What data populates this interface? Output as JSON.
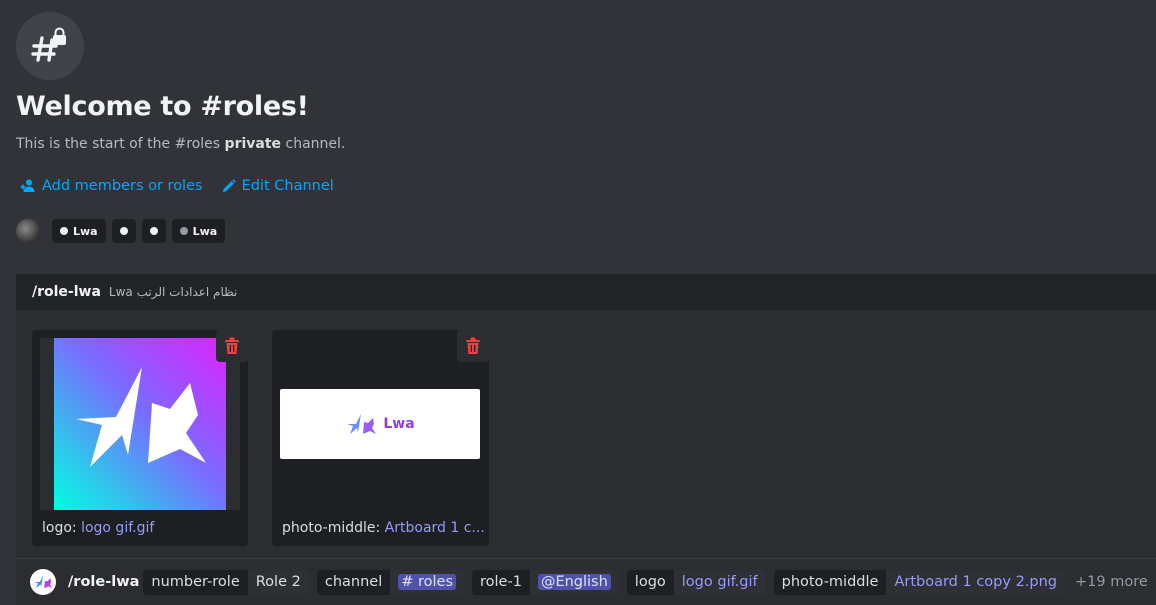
{
  "header": {
    "title": "Welcome to #roles!",
    "subtitle_pre": "This is the start of the #roles ",
    "subtitle_bold": "private",
    "subtitle_post": " channel."
  },
  "actions": {
    "add_members": "Add members or roles",
    "edit_channel": "Edit Channel"
  },
  "members": {
    "pills": [
      {
        "label": "Lwa"
      },
      {
        "label": ""
      },
      {
        "label": ""
      },
      {
        "label": "Lwa"
      }
    ]
  },
  "embed": {
    "command": "/role-lwa",
    "description": "Lwa نظام اعدادات الرتب",
    "cards": [
      {
        "label": "logo:",
        "file": "logo gif.gif"
      },
      {
        "label": "photo-middle:",
        "file": "Artboard 1 c..."
      }
    ],
    "image_brand": "Lwa"
  },
  "footer": {
    "command": "/role-lwa",
    "options": [
      {
        "name": "number-role",
        "value": "Role 2"
      },
      {
        "name": "channel",
        "value": "# roles"
      },
      {
        "name": "role-1",
        "value": "@English"
      },
      {
        "name": "logo",
        "value": "logo gif.gif"
      },
      {
        "name": "photo-middle",
        "value": "Artboard 1 copy 2.png"
      }
    ],
    "more": "+19 more"
  },
  "colors": {
    "background": "#313338",
    "link": "#00a8fc",
    "file_link": "#949cf7",
    "delete": "#f23f43"
  }
}
